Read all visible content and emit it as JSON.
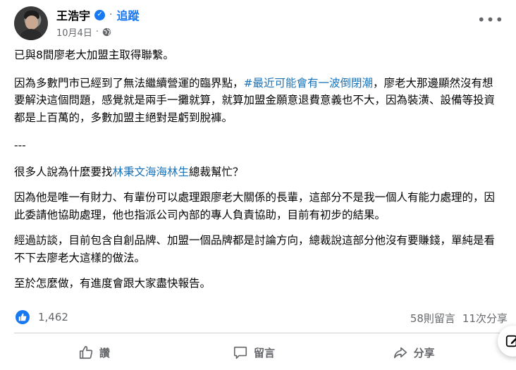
{
  "author": {
    "name": "王浩宇",
    "follow_label": "追蹤",
    "date": "10月4日"
  },
  "post": {
    "p1": "已與8間廖老大加盟主取得聯繫。",
    "p2_a": "因為多數門市已經到了無法繼續營運的臨界點，",
    "p2_hashtag": "#最近可能會有一波倒閉潮",
    "p2_b": "，廖老大那邊顯然沒有想要解決這個問題，感覺就是兩手一攤就算，就算加盟金願意退費意義也不大，因為裝潢、設備等投資都是上百萬的，多數加盟主絕對是虧到脫褲。",
    "separator": "---",
    "p3_a": "很多人說為什麼要找",
    "p3_link": "林秉文海海林生",
    "p3_b": "總裁幫忙？",
    "p4": "因為他是唯一有財力、有輩份可以處理跟廖老大關係的長輩，這部分不是我一個人有能力處理的，因此委請他協助處理，他也指派公司內部的專人負責協助，目前有初步的結果。",
    "p5": "經過訪談，目前包含自創品牌、加盟一個品牌都是討論方向，總裁說這部分他沒有要賺錢，單純是看不下去廖老大這樣的做法。",
    "p6": "至於怎麼做，有進度會跟大家盡快報告。"
  },
  "stats": {
    "likes": "1,462",
    "comments": "58則留言",
    "shares": "11次分享"
  },
  "actions": {
    "like": "讚",
    "comment": "留言",
    "share": "分享"
  },
  "colors": {
    "accent": "#1877f2",
    "link": "#1a73b8",
    "muted": "#65676b"
  }
}
